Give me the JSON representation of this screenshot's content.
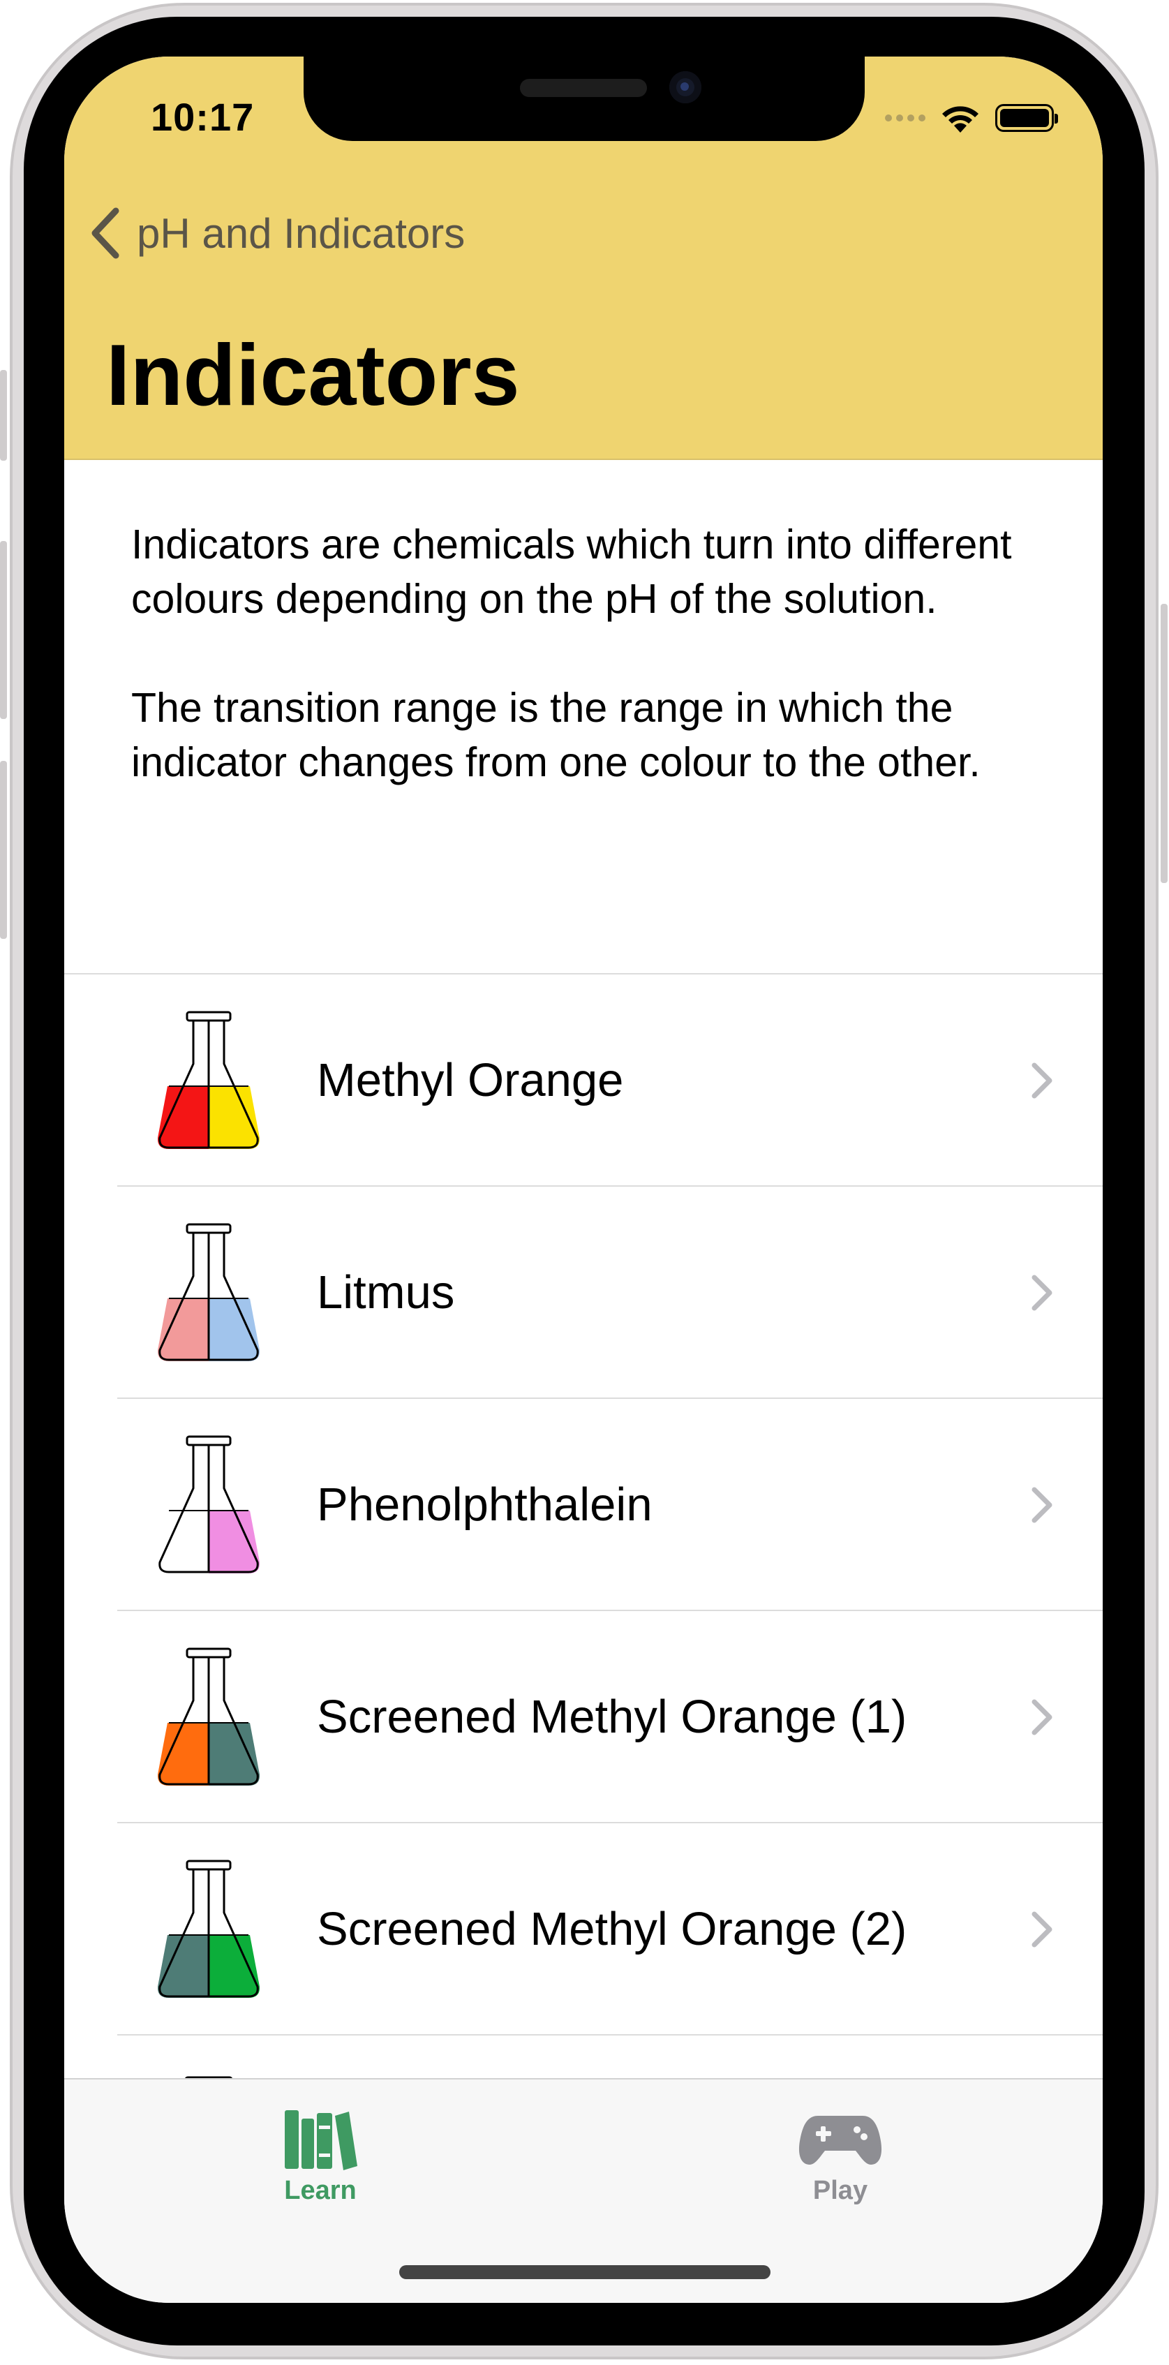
{
  "status_bar": {
    "time": "10:17"
  },
  "nav": {
    "back_label": "pH and Indicators",
    "title": "Indicators"
  },
  "intro": {
    "paragraph1": "Indicators are chemicals which turn into different colours depending on the pH of the solution.",
    "paragraph2": "The transition range is the range in which the indicator changes from one colour to the other."
  },
  "indicators": [
    {
      "label": "Methyl Orange",
      "left_color": "#f41515",
      "right_color": "#fbe200"
    },
    {
      "label": "Litmus",
      "left_color": "#f29a9a",
      "right_color": "#a1c4ec"
    },
    {
      "label": "Phenolphthalein",
      "left_color": "#ffffff",
      "right_color": "#f08ee2"
    },
    {
      "label": "Screened Methyl Orange (1)",
      "left_color": "#ff6c0e",
      "right_color": "#4e7c76"
    },
    {
      "label": "Screened Methyl Orange (2)",
      "left_color": "#4e7c76",
      "right_color": "#0cae3a"
    }
  ],
  "tabbar": {
    "learn_label": "Learn",
    "play_label": "Play",
    "active_color": "#3f9a62",
    "inactive_color": "#8e8e93"
  },
  "colors": {
    "header_bg": "#efd470"
  }
}
